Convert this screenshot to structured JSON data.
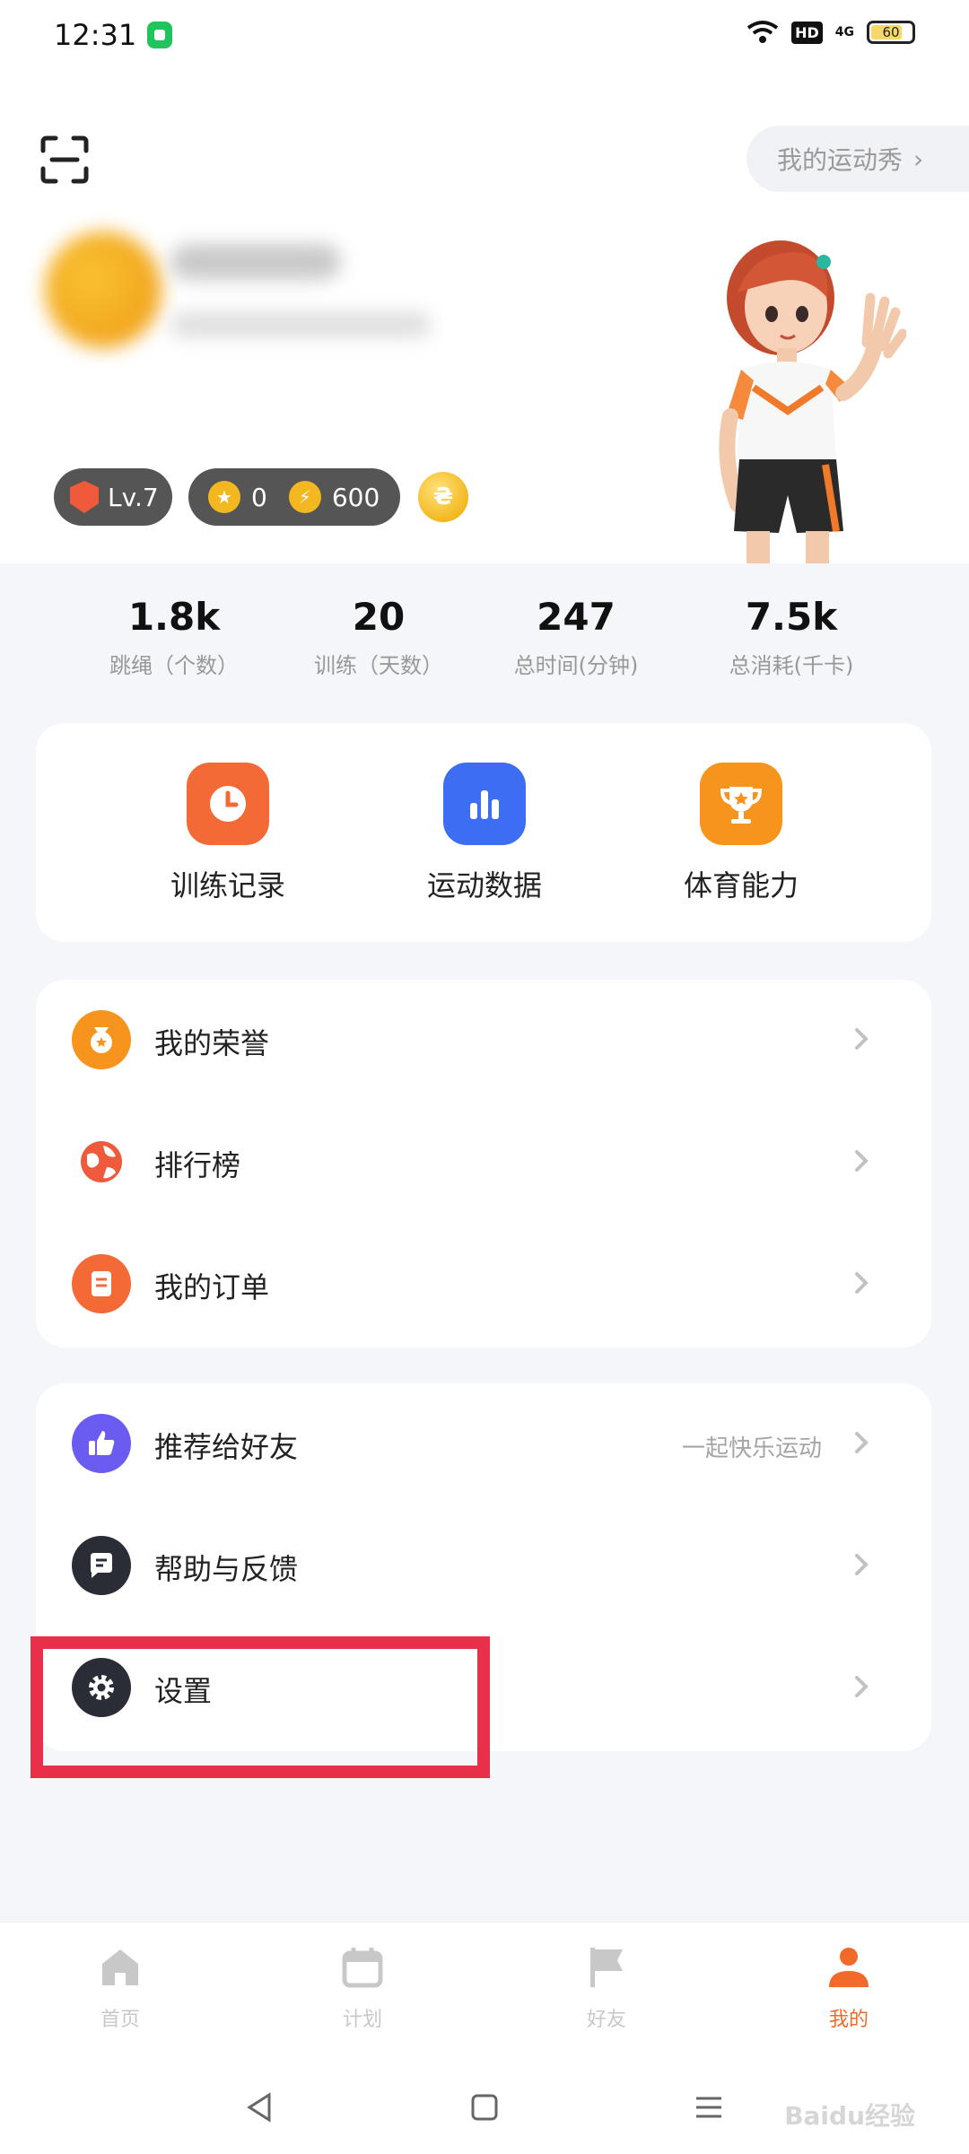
{
  "status_bar": {
    "time": "12:31",
    "hd": "HD",
    "signal": "4G",
    "battery": "60"
  },
  "header": {
    "sports_show": "我的运动秀",
    "chevron": "›"
  },
  "profile": {
    "level": "Lv.7",
    "stars": "0",
    "energy": "600",
    "gold_coin_glyph": "₴"
  },
  "stats": [
    {
      "value": "1.8k",
      "label": "跳绳（个数）"
    },
    {
      "value": "20",
      "label": "训练（天数）"
    },
    {
      "value": "247",
      "label": "总时间(分钟)"
    },
    {
      "value": "7.5k",
      "label": "总消耗(千卡)"
    }
  ],
  "quick_actions": [
    {
      "label": "训练记录",
      "icon": "clock-icon",
      "color": "#f46a36"
    },
    {
      "label": "运动数据",
      "icon": "bar-chart-icon",
      "color": "#3d6df2"
    },
    {
      "label": "体育能力",
      "icon": "trophy-icon",
      "color": "#f7941d"
    }
  ],
  "menu_group_1": [
    {
      "label": "我的荣誉",
      "icon": "medal-icon",
      "color": "#f7941d"
    },
    {
      "label": "排行榜",
      "icon": "globe-icon",
      "color": "#f05a3c"
    },
    {
      "label": "我的订单",
      "icon": "order-icon",
      "color": "#f46a36"
    }
  ],
  "menu_group_2": [
    {
      "label": "推荐给好友",
      "right_text": "一起快乐运动",
      "icon": "thumbs-up-icon",
      "color": "#6a5cf0"
    },
    {
      "label": "帮助与反馈",
      "right_text": "",
      "icon": "chat-icon",
      "color": "#2a2d36"
    },
    {
      "label": "设置",
      "right_text": "",
      "icon": "gear-icon",
      "color": "#2a2d36"
    }
  ],
  "highlight_color": "#e8304a",
  "bottom_nav": [
    {
      "label": "首页",
      "icon": "home-icon",
      "active": false
    },
    {
      "label": "计划",
      "icon": "calendar-icon",
      "active": false
    },
    {
      "label": "好友",
      "icon": "flag-icon",
      "active": false
    },
    {
      "label": "我的",
      "icon": "person-icon",
      "active": true
    }
  ],
  "watermark": "Baidu经验"
}
